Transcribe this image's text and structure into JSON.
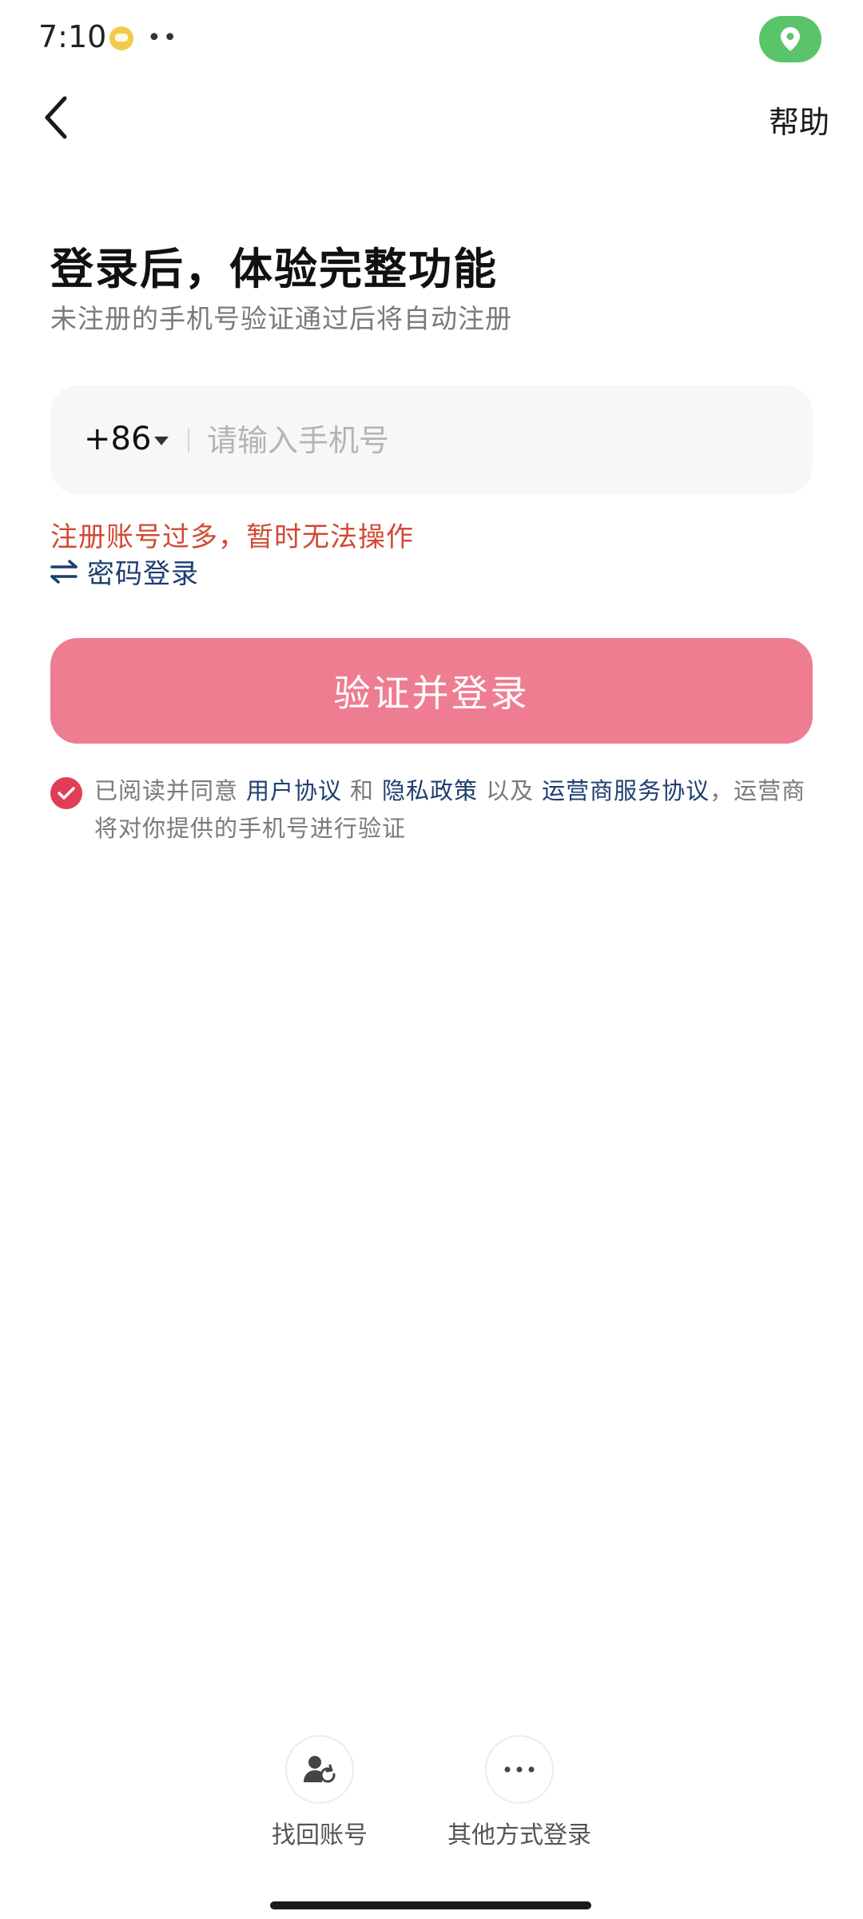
{
  "status_bar": {
    "time": "7:10",
    "dots": "••",
    "location_color": "#5ac46a"
  },
  "nav": {
    "help_label": "帮助"
  },
  "header": {
    "title": "登录后，体验完整功能",
    "subtitle": "未注册的手机号验证通过后将自动注册"
  },
  "phone": {
    "country_code": "+86",
    "value": "",
    "placeholder": "请输入手机号"
  },
  "error": {
    "message": "注册账号过多，暂时无法操作"
  },
  "password_login": {
    "label": "密码登录"
  },
  "login_button": {
    "label": "验证并登录",
    "color": "#ef7d91"
  },
  "agreement": {
    "checked": true,
    "prefix": "已阅读并同意",
    "user_agreement": "用户协议",
    "and": "和",
    "privacy_policy": "隐私政策",
    "as_well_as": "以及",
    "carrier_agreement": "运营商服务协议",
    "suffix": "，运营商将对你提供的手机号进行验证"
  },
  "bottom": {
    "find_account": "找回账号",
    "other_login": "其他方式登录"
  },
  "colors": {
    "error": "#d14a35",
    "link": "#1e3f6f",
    "check": "#e23d58"
  }
}
